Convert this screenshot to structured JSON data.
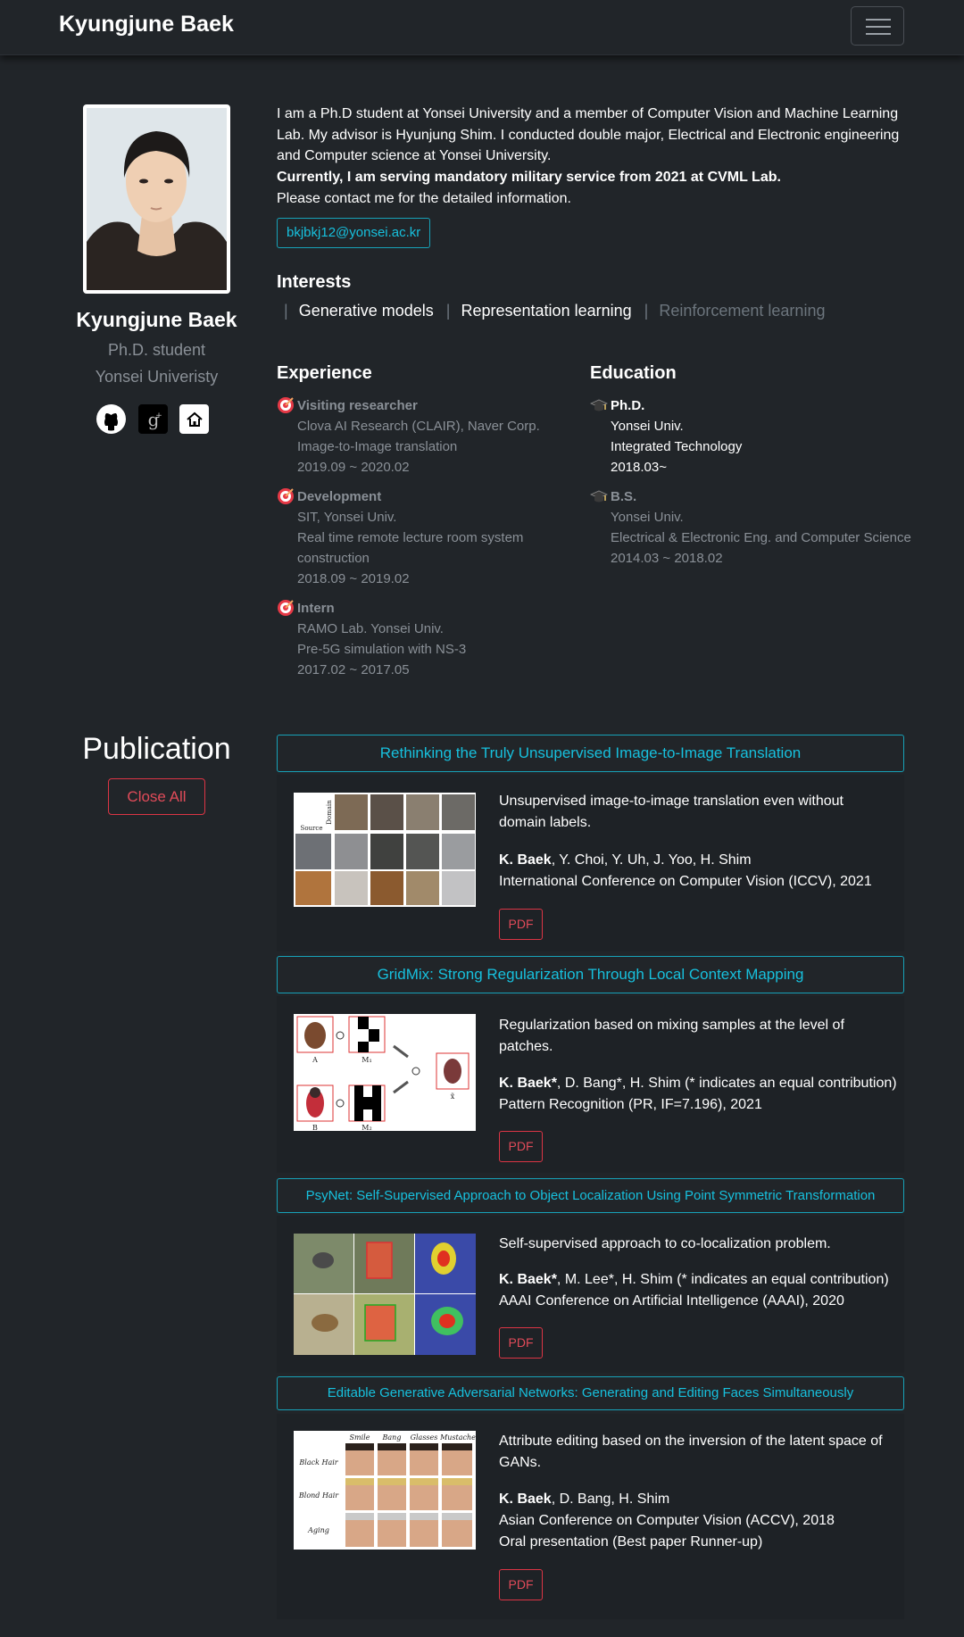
{
  "navbar": {
    "brand": "Kyungjune Baek"
  },
  "profile": {
    "name": "Kyungjune Baek",
    "role": "Ph.D. student",
    "university": "Yonsei Univeristy",
    "social_icons": [
      "github-icon",
      "google-scholar-icon",
      "home-icon"
    ]
  },
  "intro": {
    "line1": "I am a Ph.D student at Yonsei University and a member of Computer Vision and Machine Learning Lab. My advisor is Hyunjung Shim. I conducted double major, Electrical and Electronic engineering and Computer science at Yonsei University.",
    "line2": "Currently, I am serving mandatory military service from 2021 at CVML Lab.",
    "line3": "Please contact me for the detailed information.",
    "email": "bkjbkj12@yonsei.ac.kr"
  },
  "interests": {
    "heading": "Interests",
    "items": [
      "Generative models",
      "Representation learning",
      "Reinforcement learning"
    ]
  },
  "experience": {
    "heading": "Experience",
    "items": [
      {
        "title": "Visiting researcher",
        "lines": [
          "Clova AI Research (CLAIR), Naver Corp.",
          "Image-to-Image translation",
          "2019.09 ~ 2020.02"
        ]
      },
      {
        "title": "Development",
        "lines": [
          "SIT, Yonsei Univ.",
          "Real time remote lecture room system",
          "construction",
          "2018.09 ~ 2019.02"
        ]
      },
      {
        "title": "Intern",
        "lines": [
          "RAMO Lab. Yonsei Univ.",
          "Pre-5G simulation with NS-3",
          "2017.02 ~ 2017.05"
        ]
      }
    ]
  },
  "education": {
    "heading": "Education",
    "items": [
      {
        "title": "Ph.D.",
        "lines": [
          "Yonsei Univ.",
          "Integrated Technology",
          "2018.03~"
        ]
      },
      {
        "title": "B.S.",
        "lines": [
          "Yonsei Univ.",
          "Electrical & Electronic Eng. and Computer Science",
          "2014.03 ~ 2018.02"
        ]
      }
    ]
  },
  "publication": {
    "heading": "Publication",
    "close_all": "Close All",
    "pdf_label": "PDF",
    "items": [
      {
        "title": "Rethinking the Truly Unsupervised Image-to-Image Translation",
        "desc": "Unsupervised image-to-image translation even without domain labels.",
        "first_author": "K. Baek",
        "authors_rest": ", Y. Choi, Y. Uh, J. Yoo, H. Shim",
        "venue": "International Conference on Computer Vision (ICCV), 2021",
        "note": "",
        "thumb_labels": [
          "Source",
          "Domain"
        ]
      },
      {
        "title": "GridMix: Strong Regularization Through Local Context Mapping",
        "desc": "Regularization based on mixing samples at the level of patches.",
        "first_author": "K. Baek*",
        "authors_rest": ", D. Bang*, H. Shim (* indicates an equal contribution)",
        "venue": "Pattern Recognition (PR, IF=7.196), 2021",
        "note": "",
        "thumb_labels": [
          "A",
          "M₁",
          "B",
          "M₂",
          "x̃"
        ]
      },
      {
        "title": "PsyNet: Self-Supervised Approach to Object Localization Using Point Symmetric Transformation",
        "desc": "Self-supervised approach to co-localization problem.",
        "first_author": "K. Baek*",
        "authors_rest": ", M. Lee*, H. Shim (* indicates an equal contribution)",
        "venue": "AAAI Conference on Artificial Intelligence (AAAI), 2020",
        "note": "",
        "thumb_labels": []
      },
      {
        "title": "Editable Generative Adversarial Networks: Generating and Editing Faces Simultaneously",
        "desc": "Attribute editing based on the inversion of the latent space of GANs.",
        "first_author": "K. Baek",
        "authors_rest": ", D. Bang, H. Shim",
        "venue": "Asian Conference on Computer Vision (ACCV), 2018",
        "note": "Oral presentation (Best paper Runner-up)",
        "thumb_labels": [
          "Smile",
          "Bang",
          "Glasses",
          "Mustache",
          "Black Hair",
          "Blond Hair",
          "Aging"
        ]
      }
    ]
  },
  "colors": {
    "background": "#212529",
    "accent": "#17a2b8",
    "danger": "#dc3545",
    "muted": "#8a9097"
  }
}
